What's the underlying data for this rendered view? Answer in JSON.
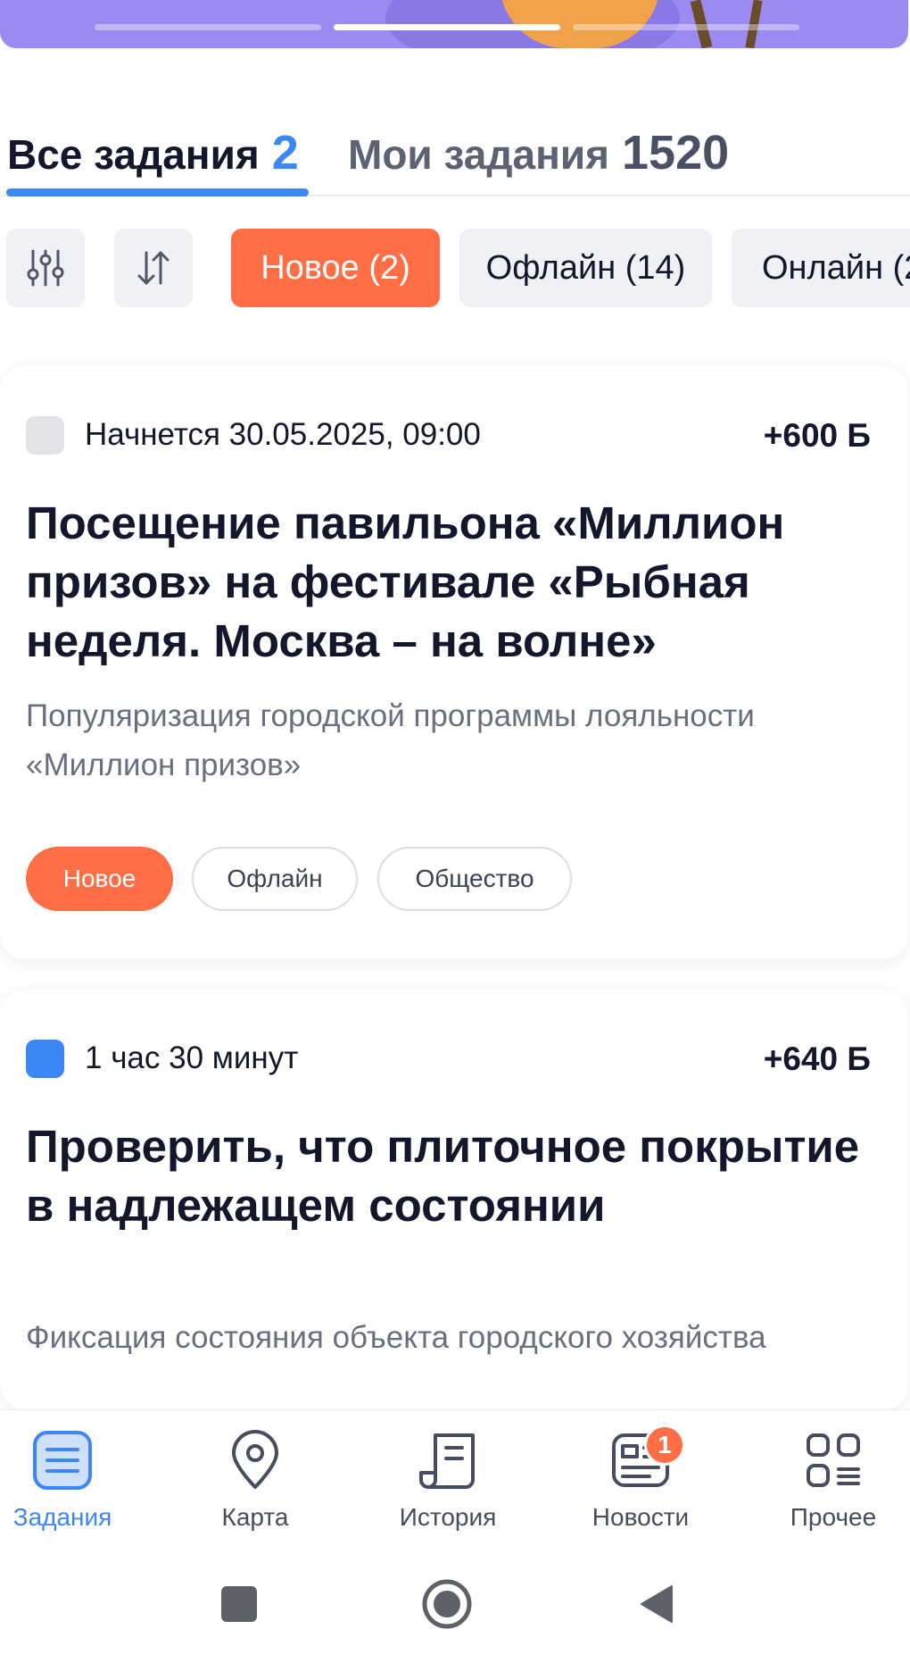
{
  "banner": {
    "slides_total": 3,
    "active_slide": 2
  },
  "tabs": {
    "all": {
      "label": "Все задания",
      "count": "2"
    },
    "mine": {
      "label": "Мои задания",
      "count": "1520"
    }
  },
  "filters": {
    "settings_icon": "sliders-icon",
    "sort_icon": "sort-arrows-icon",
    "chips": [
      {
        "label": "Новое (2)",
        "active": true
      },
      {
        "label": "Офлайн (14)",
        "active": false
      },
      {
        "label": "Онлайн (2",
        "active": false
      }
    ]
  },
  "tasks": [
    {
      "status_color": "#e3e4e9",
      "meta": "Начнется 30.05.2025, 09:00",
      "points": "+600 Б",
      "title": "Посещение павильона «Миллион призов» на фестивале «Рыбная неделя. Москва – на волне»",
      "description": "Популяризация городской программы лояльности «Миллион призов»",
      "tags": [
        "Новое",
        "Офлайн",
        "Общество"
      ]
    },
    {
      "status_color": "#3d86f5",
      "meta": "1 час 30 минут",
      "points": "+640 Б",
      "title": "Проверить, что плиточное покрытие в надлежащем состоянии",
      "description": "Фиксация состояния объекта городского хозяйства"
    }
  ],
  "bottom_nav": {
    "items": [
      {
        "label": "Задания",
        "icon": "tasks-list-icon",
        "active": true
      },
      {
        "label": "Карта",
        "icon": "map-pin-icon",
        "active": false
      },
      {
        "label": "История",
        "icon": "history-scroll-icon",
        "active": false
      },
      {
        "label": "Новости",
        "icon": "news-icon",
        "active": false,
        "badge": "1"
      },
      {
        "label": "Прочее",
        "icon": "more-grid-icon",
        "active": false
      }
    ]
  },
  "system_nav": {
    "recents_icon": "square-icon",
    "home_icon": "circle-home-icon",
    "back_icon": "triangle-back-icon"
  },
  "colors": {
    "accent": "#3d86f5",
    "highlight": "#ff6e45",
    "banner": "#9b8af0",
    "text": "#14162b",
    "muted": "#6a6f80"
  }
}
